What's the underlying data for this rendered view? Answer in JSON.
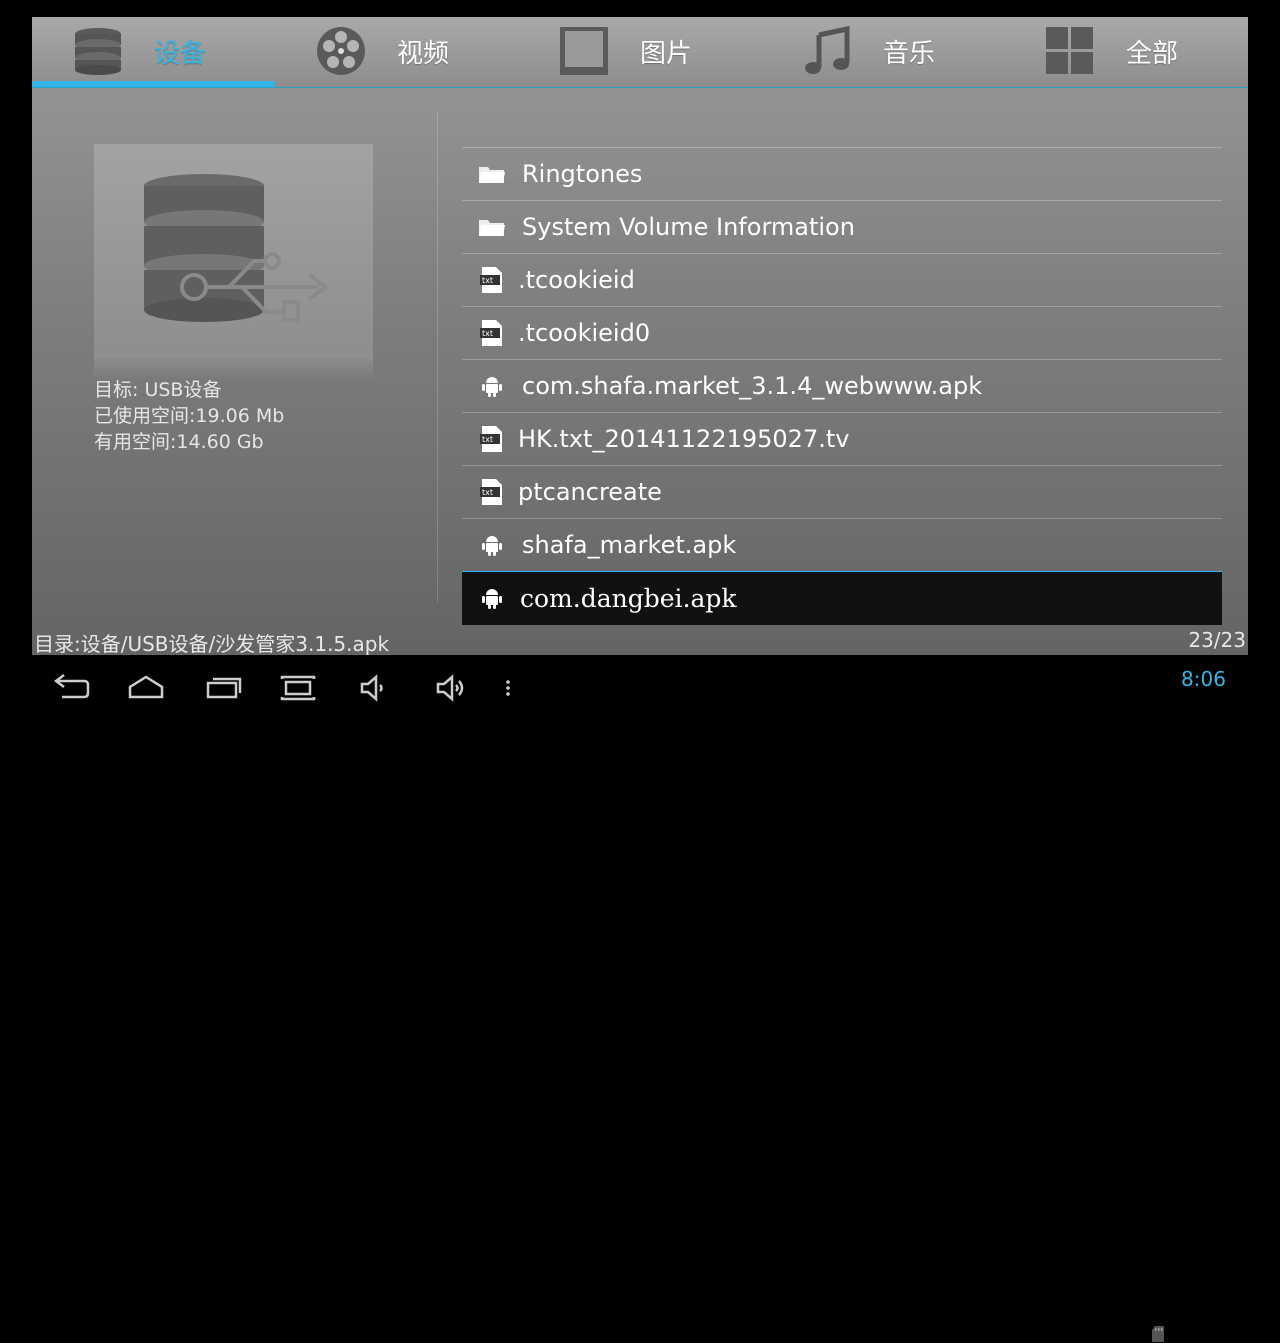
{
  "tabs": [
    {
      "label": "设备",
      "icon": "database-icon",
      "active": true
    },
    {
      "label": "视频",
      "icon": "film-reel-icon",
      "active": false
    },
    {
      "label": "图片",
      "icon": "picture-frame-icon",
      "active": false
    },
    {
      "label": "音乐",
      "icon": "music-note-icon",
      "active": false
    },
    {
      "label": "全部",
      "icon": "grid-icon",
      "active": false
    }
  ],
  "device_info": {
    "target": "目标: USB设备",
    "used": "已使用空间:19.06 Mb",
    "free": "有用空间:14.60 Gb"
  },
  "files": [
    {
      "name": "Ringtones",
      "type": "folder"
    },
    {
      "name": "System Volume Information",
      "type": "folder"
    },
    {
      "name": ".tcookieid",
      "type": "txt"
    },
    {
      "name": ".tcookieid0",
      "type": "txt"
    },
    {
      "name": "com.shafa.market_3.1.4_webwww.apk",
      "type": "apk"
    },
    {
      "name": "HK.txt_20141122195027.tv",
      "type": "txt"
    },
    {
      "name": "ptcancreate",
      "type": "txt"
    },
    {
      "name": "shafa_market.apk",
      "type": "apk"
    },
    {
      "name": "com.dangbei.apk",
      "type": "apk",
      "selected": true
    }
  ],
  "status": {
    "path": "目录:设备/USB设备/沙发管家3.1.5.apk",
    "counter": "23/23"
  },
  "system_bar": {
    "clock": "8:06",
    "accent_color": "#33b5e5"
  }
}
